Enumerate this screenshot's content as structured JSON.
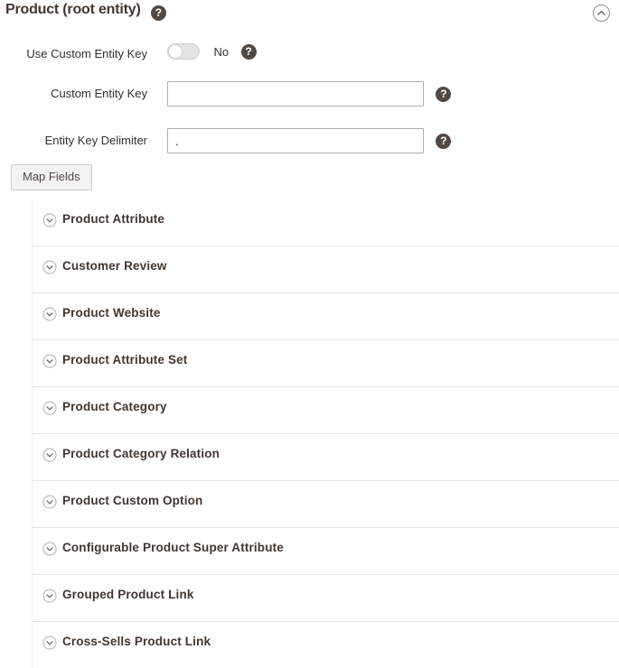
{
  "fieldset": {
    "title": "Product (root entity)",
    "help_icon": "help-icon",
    "help_glyph": "?",
    "collapse_icon": "chevron-up-circle-icon"
  },
  "form": {
    "fields": [
      {
        "label": "Use Custom Entity Key",
        "type": "toggle",
        "state_label": "No",
        "checked": false
      },
      {
        "label": "Custom Entity Key",
        "type": "text",
        "value": "",
        "placeholder": ""
      },
      {
        "label": "Entity Key Delimiter",
        "type": "text",
        "value": ".",
        "placeholder": ""
      }
    ],
    "map_fields_button": "Map Fields"
  },
  "sections": [
    {
      "label": "Product Attribute",
      "icon": "chevron-down-circle-icon"
    },
    {
      "label": "Customer Review",
      "icon": "chevron-down-circle-icon"
    },
    {
      "label": "Product Website",
      "icon": "chevron-down-circle-icon"
    },
    {
      "label": "Product Attribute Set",
      "icon": "chevron-down-circle-icon"
    },
    {
      "label": "Product Category",
      "icon": "chevron-down-circle-icon"
    },
    {
      "label": "Product Category Relation",
      "icon": "chevron-down-circle-icon"
    },
    {
      "label": "Product Custom Option",
      "icon": "chevron-down-circle-icon"
    },
    {
      "label": "Configurable Product Super Attribute",
      "icon": "chevron-down-circle-icon"
    },
    {
      "label": "Grouped Product Link",
      "icon": "chevron-down-circle-icon"
    },
    {
      "label": "Cross-Sells Product Link",
      "icon": "chevron-down-circle-icon"
    }
  ],
  "colors": {
    "title": "#41362f",
    "help_badge": "#514943",
    "border": "#adadad",
    "divider": "#e3e3e3",
    "button_bg": "#f2f2f2"
  }
}
